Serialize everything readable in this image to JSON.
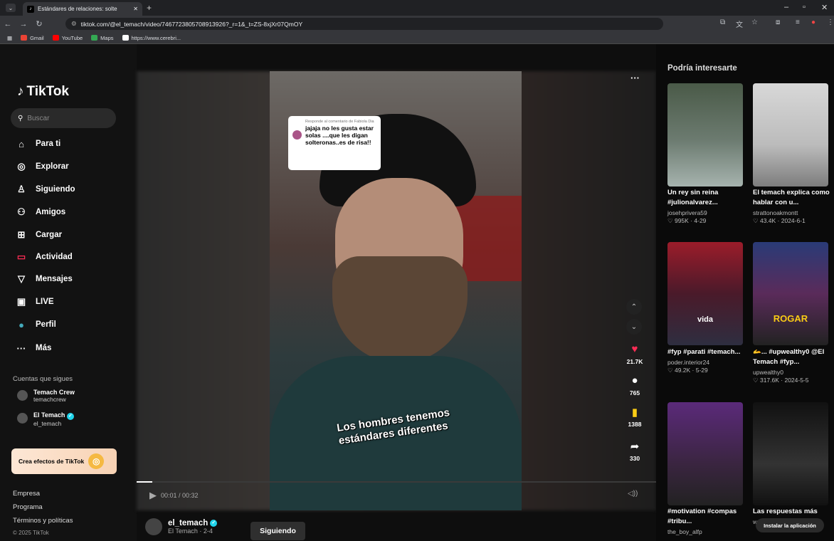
{
  "browser": {
    "tab_title": "Estándares de relaciones: solte",
    "url": "tiktok.com/@el_temach/video/7467723805708913926?_r=1&_t=ZS-8xjXr07QmOY",
    "bookmarks": [
      "Gmail",
      "YouTube",
      "Maps",
      "https://www.cerebri..."
    ]
  },
  "sidebar": {
    "logo": "TikTok",
    "search_placeholder": "Buscar",
    "nav": [
      {
        "label": "Para ti",
        "icon": "home-icon"
      },
      {
        "label": "Explorar",
        "icon": "compass-icon"
      },
      {
        "label": "Siguiendo",
        "icon": "following-icon"
      },
      {
        "label": "Amigos",
        "icon": "friends-icon"
      },
      {
        "label": "Cargar",
        "icon": "upload-icon"
      },
      {
        "label": "Actividad",
        "icon": "activity-icon"
      },
      {
        "label": "Mensajes",
        "icon": "messages-icon"
      },
      {
        "label": "LIVE",
        "icon": "live-icon"
      },
      {
        "label": "Perfil",
        "icon": "profile-icon"
      },
      {
        "label": "Más",
        "icon": "more-icon"
      }
    ],
    "following_title": "Cuentas que sigues",
    "following": [
      {
        "name": "Temach Crew",
        "handle": "temachcrew"
      },
      {
        "name": "El Temach",
        "handle": "el_temach"
      }
    ],
    "effects_label": "Crea efectos de TikTok",
    "footer": [
      "Empresa",
      "Programa",
      "Términos y políticas",
      "© 2025 TikTok"
    ]
  },
  "video": {
    "comment_reply_label": "Responde al comentario de Fabiola Dia",
    "comment_text": "jajaja no les gusta estar solas ....que les digan solteronas..es de risa!!",
    "caption_line1": "Los hombres tenemos",
    "caption_line2": "estándares diferentes",
    "time": "00:01 / 00:32",
    "progress": 0.03,
    "likes": "21.7K",
    "comments": "765",
    "saves": "1388",
    "shares": "330",
    "author_handle": "el_temach",
    "author_sub": "El Temach · 2-4",
    "follow_label": "Siguiendo"
  },
  "right": {
    "title": "Podría interesarte",
    "cards": [
      {
        "title": "Un rey sin reina #julionalvarez...",
        "user": "josehprivera59",
        "stats": "♡ 995K · 4-29",
        "overlay": ""
      },
      {
        "title": "El temach explica como hablar con u...",
        "user": "strattonoakmontt",
        "stats": "♡ 43.4K · 2024-6-1",
        "overlay": ""
      },
      {
        "title": "#fyp #parati #temach...",
        "user": "poder.interior24",
        "stats": "♡ 49.2K · 5-29",
        "overlay": "vida"
      },
      {
        "title": "🫴... #upwealthy0 @El Temach #fyp...",
        "user": "upwealthy0",
        "stats": "♡ 317.6K · 2024-5-5",
        "overlay": "ROGAR"
      },
      {
        "title": "#motivation #compas #tribu...",
        "user": "the_boy_alfp",
        "stats": "",
        "overlay": ""
      },
      {
        "title": "Las respuestas más",
        "user": "warexmpentos1",
        "stats": "",
        "overlay": ""
      }
    ],
    "install_label": "Instalar la aplicación"
  },
  "colors": {
    "accent": "#fe2c55",
    "save": "#facc15",
    "verified": "#20d5ec"
  }
}
